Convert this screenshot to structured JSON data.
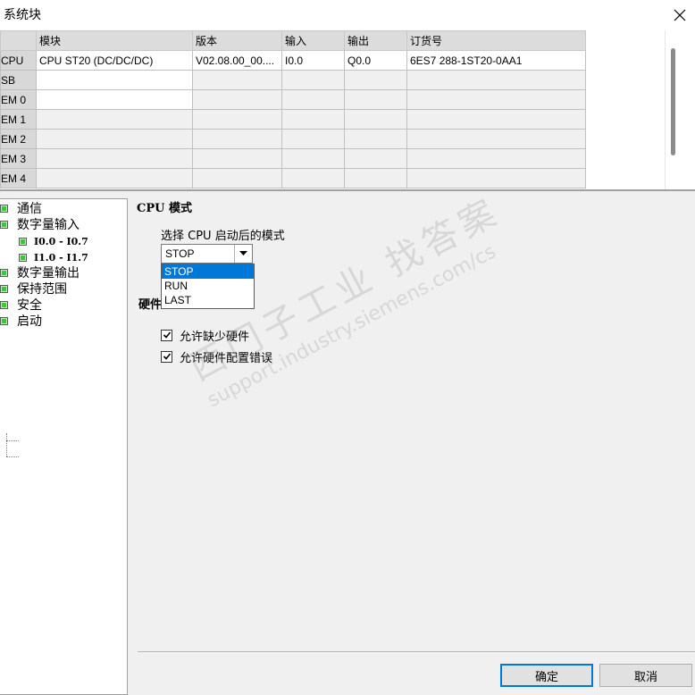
{
  "window": {
    "title": "系统块"
  },
  "grid": {
    "headers": [
      "",
      "模块",
      "版本",
      "输入",
      "输出",
      "订货号"
    ],
    "rows": [
      {
        "label": "CPU",
        "module": "CPU ST20 (DC/DC/DC)",
        "version": "V02.08.00_00....",
        "input": "I0.0",
        "output": "Q0.0",
        "order": "6ES7 288-1ST20-0AA1"
      },
      {
        "label": "SB",
        "module": "",
        "version": "",
        "input": "",
        "output": "",
        "order": ""
      },
      {
        "label": "EM 0",
        "module": "",
        "version": "",
        "input": "",
        "output": "",
        "order": ""
      },
      {
        "label": "EM 1",
        "module": "",
        "version": "",
        "input": "",
        "output": "",
        "order": ""
      },
      {
        "label": "EM 2",
        "module": "",
        "version": "",
        "input": "",
        "output": "",
        "order": ""
      },
      {
        "label": "EM 3",
        "module": "",
        "version": "",
        "input": "",
        "output": "",
        "order": ""
      },
      {
        "label": "EM 4",
        "module": "",
        "version": "",
        "input": "",
        "output": "",
        "order": ""
      }
    ]
  },
  "tree": {
    "items": [
      {
        "label": "通信"
      },
      {
        "label": "数字量输入"
      },
      {
        "label": "I0.0 - I0.7"
      },
      {
        "label": "I1.0 - I1.7"
      },
      {
        "label": "数字量输出"
      },
      {
        "label": "保持范围"
      },
      {
        "label": "安全"
      },
      {
        "label": "启动"
      }
    ]
  },
  "startup": {
    "section_title": "CPU 模式",
    "select_label": "选择 CPU 启动后的模式",
    "selected_value": "STOP",
    "options": [
      "STOP",
      "RUN",
      "LAST"
    ],
    "hw_section_title": "硬件",
    "checkboxes": [
      {
        "label": "允许缺少硬件",
        "checked": true
      },
      {
        "label": "允许硬件配置错误",
        "checked": true
      }
    ]
  },
  "buttons": {
    "ok": "确定",
    "cancel": "取消"
  },
  "watermark": {
    "line1": "西门子工业 找答案",
    "line2": "support.industry.siemens.com/cs"
  },
  "colors": {
    "selection": "#0078d7",
    "tree_node": "#39c839"
  }
}
